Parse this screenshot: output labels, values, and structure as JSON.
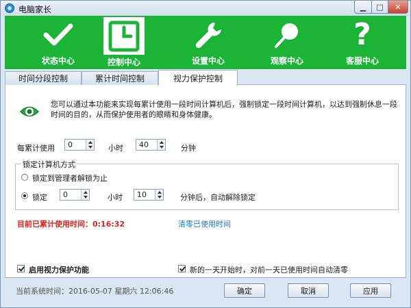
{
  "window": {
    "title": "电脑家长"
  },
  "banner": {
    "items": [
      {
        "label": "状态中心",
        "icon": "checkmark-icon"
      },
      {
        "label": "控制中心",
        "icon": "clock-icon"
      },
      {
        "label": "设置中心",
        "icon": "wrench-icon"
      },
      {
        "label": "观察中心",
        "icon": "magnifier-icon"
      },
      {
        "label": "客服中心",
        "icon": "question-icon"
      }
    ],
    "active": 1,
    "color": "#1bb437"
  },
  "tabs": [
    {
      "label": "时间分段控制"
    },
    {
      "label": "累计时间控制"
    },
    {
      "label": "视力保护控制"
    }
  ],
  "active_tab": 2,
  "panel": {
    "description": "您可以通过本功能来实现每累计使用一段时间计算机后，强制锁定一段时间计算机，以达到强制休息一段时间的目的，从而保护使用者的眼睛和身体健康。",
    "usage_label": "每累计使用",
    "usage_hours": "0",
    "hours_unit": "小时",
    "usage_minutes": "40",
    "minutes_unit": "分钟",
    "lock_group_title": "锁定计算机方式",
    "lock_option_admin": "锁定到管理者解锁为止",
    "lock_option_timed": "锁定",
    "lock_hours": "0",
    "lock_hours_unit": "小时",
    "lock_minutes": "10",
    "lock_minutes_suffix": "分钟后，自动解除锁定",
    "used_time_text": "目前已累计使用时间：0:16:32",
    "clear_link": "清零已使用时间",
    "enable_protection": "启用视力保护功能",
    "new_day_reset": "新的一天开始时，对前一天已使用时间自动清零"
  },
  "footer": {
    "system_time": "当前系统时间：2016-05-07  星期六  12:06:46",
    "ok": "确定",
    "cancel": "取消",
    "apply": "应用"
  }
}
